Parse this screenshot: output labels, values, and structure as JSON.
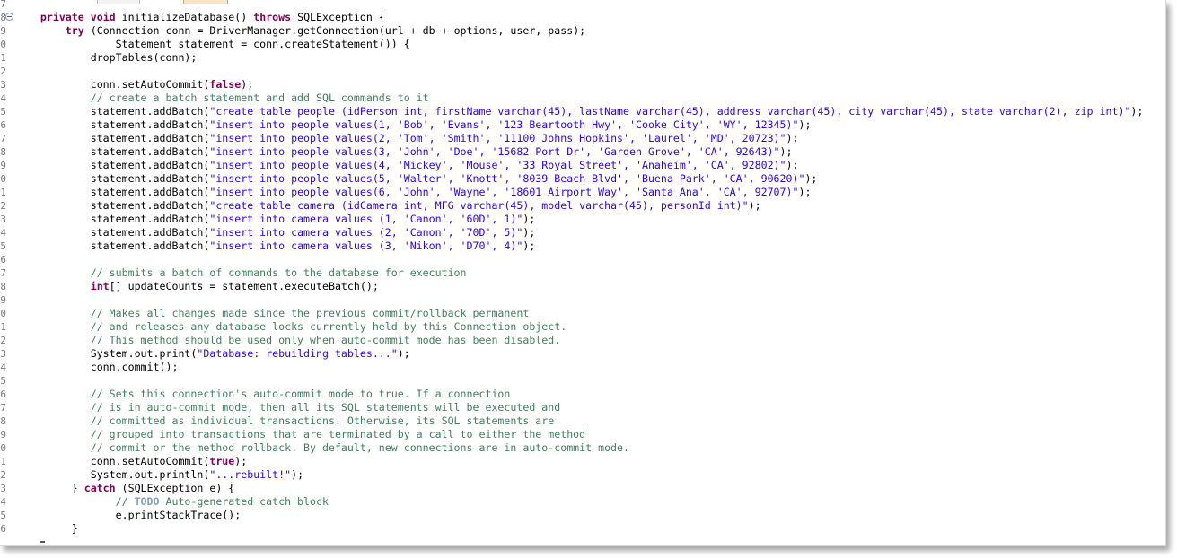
{
  "editor": {
    "lines": [
      {
        "n": "7",
        "indent": 0,
        "text": ""
      },
      {
        "n": "8",
        "indent": 6,
        "fold": true,
        "tokens": [
          {
            "t": "kw",
            "v": "private"
          },
          {
            "t": "p",
            "v": " "
          },
          {
            "t": "kw",
            "v": "void"
          },
          {
            "t": "p",
            "v": " initializeDatabase() "
          },
          {
            "t": "kw",
            "v": "throws"
          },
          {
            "t": "p",
            "v": " SQLException {"
          }
        ]
      },
      {
        "n": "9",
        "indent": 10,
        "tokens": [
          {
            "t": "kw",
            "v": "try"
          },
          {
            "t": "p",
            "v": " (Connection conn = DriverManager.getConnection(url + db + options, user, pass);"
          }
        ]
      },
      {
        "n": "0",
        "indent": 18,
        "tokens": [
          {
            "t": "p",
            "v": "Statement statement = conn.createStatement()) {"
          }
        ]
      },
      {
        "n": "1",
        "indent": 14,
        "tokens": [
          {
            "t": "p",
            "v": "dropTables(conn);"
          }
        ]
      },
      {
        "n": "2",
        "indent": 0,
        "tokens": []
      },
      {
        "n": "3",
        "indent": 14,
        "tokens": [
          {
            "t": "p",
            "v": "conn.setAutoCommit("
          },
          {
            "t": "kw",
            "v": "false"
          },
          {
            "t": "p",
            "v": ");"
          }
        ]
      },
      {
        "n": "4",
        "indent": 14,
        "tokens": [
          {
            "t": "cm",
            "v": "// create a batch statement and add SQL commands to it"
          }
        ]
      },
      {
        "n": "5",
        "indent": 14,
        "tokens": [
          {
            "t": "p",
            "v": "statement.addBatch("
          },
          {
            "t": "str",
            "v": "\"create table people (idPerson int, firstName varchar(45), lastName varchar(45), address varchar(45), city varchar(45), state varchar(2), zip int)\""
          },
          {
            "t": "p",
            "v": ");"
          }
        ]
      },
      {
        "n": "6",
        "indent": 14,
        "tokens": [
          {
            "t": "p",
            "v": "statement.addBatch("
          },
          {
            "t": "str",
            "v": "\"insert into people values(1, 'Bob', 'Evans', '123 Beartooth Hwy', 'Cooke City', 'WY', 12345)\""
          },
          {
            "t": "p",
            "v": ");"
          }
        ]
      },
      {
        "n": "7",
        "indent": 14,
        "tokens": [
          {
            "t": "p",
            "v": "statement.addBatch("
          },
          {
            "t": "str",
            "v": "\"insert into people values(2, 'Tom', 'Smith', '11100 Johns Hopkins', 'Laurel', 'MD', 20723)\""
          },
          {
            "t": "p",
            "v": ");"
          }
        ]
      },
      {
        "n": "8",
        "indent": 14,
        "tokens": [
          {
            "t": "p",
            "v": "statement.addBatch("
          },
          {
            "t": "str",
            "v": "\"insert into people values(3, 'John', 'Doe', '15682 Port Dr', 'Garden Grove', 'CA', 92643)\""
          },
          {
            "t": "p",
            "v": ");"
          }
        ]
      },
      {
        "n": "9",
        "indent": 14,
        "tokens": [
          {
            "t": "p",
            "v": "statement.addBatch("
          },
          {
            "t": "str",
            "v": "\"insert into people values(4, 'Mickey', 'Mouse', '33 Royal Street', 'Anaheim', 'CA', 92802)\""
          },
          {
            "t": "p",
            "v": ");"
          }
        ]
      },
      {
        "n": "0",
        "indent": 14,
        "tokens": [
          {
            "t": "p",
            "v": "statement.addBatch("
          },
          {
            "t": "str",
            "v": "\"insert into people values(5, 'Walter', 'Knott', '8039 Beach Blvd', 'Buena Park', 'CA', 90620)\""
          },
          {
            "t": "p",
            "v": ");"
          }
        ]
      },
      {
        "n": "1",
        "indent": 14,
        "tokens": [
          {
            "t": "p",
            "v": "statement.addBatch("
          },
          {
            "t": "str",
            "v": "\"insert into people values(6, 'John', 'Wayne', '18601 Airport Way', 'Santa Ana', 'CA', 92707)\""
          },
          {
            "t": "p",
            "v": ");"
          }
        ]
      },
      {
        "n": "2",
        "indent": 14,
        "tokens": [
          {
            "t": "p",
            "v": "statement.addBatch("
          },
          {
            "t": "str",
            "v": "\"create table camera (idCamera int, MFG varchar(45), model varchar(45), personId int)\""
          },
          {
            "t": "p",
            "v": ");"
          }
        ]
      },
      {
        "n": "3",
        "indent": 14,
        "tokens": [
          {
            "t": "p",
            "v": "statement.addBatch("
          },
          {
            "t": "str",
            "v": "\"insert into camera values (1, 'Canon', '60D', 1)\""
          },
          {
            "t": "p",
            "v": ");"
          }
        ]
      },
      {
        "n": "4",
        "indent": 14,
        "tokens": [
          {
            "t": "p",
            "v": "statement.addBatch("
          },
          {
            "t": "str",
            "v": "\"insert into camera values (2, 'Canon', '70D', 5)\""
          },
          {
            "t": "p",
            "v": ");"
          }
        ]
      },
      {
        "n": "5",
        "indent": 14,
        "tokens": [
          {
            "t": "p",
            "v": "statement.addBatch("
          },
          {
            "t": "str",
            "v": "\"insert into camera values (3, 'Nikon', 'D70', 4)\""
          },
          {
            "t": "p",
            "v": ");"
          }
        ]
      },
      {
        "n": "6",
        "indent": 0,
        "tokens": []
      },
      {
        "n": "7",
        "indent": 14,
        "tokens": [
          {
            "t": "cm",
            "v": "// submits a batch of commands to the database for execution"
          }
        ]
      },
      {
        "n": "8",
        "indent": 14,
        "tokens": [
          {
            "t": "kw",
            "v": "int"
          },
          {
            "t": "p",
            "v": "[] updateCounts = statement.executeBatch();"
          }
        ]
      },
      {
        "n": "9",
        "indent": 0,
        "tokens": []
      },
      {
        "n": "0",
        "indent": 14,
        "tokens": [
          {
            "t": "cm",
            "v": "// Makes all changes made since the previous commit/rollback permanent"
          }
        ]
      },
      {
        "n": "1",
        "indent": 14,
        "tokens": [
          {
            "t": "cm",
            "v": "// and releases any database locks currently held by this Connection object."
          }
        ]
      },
      {
        "n": "2",
        "indent": 14,
        "tokens": [
          {
            "t": "cm",
            "v": "// This method should be used only when auto-commit mode has been disabled."
          }
        ]
      },
      {
        "n": "3",
        "indent": 14,
        "tokens": [
          {
            "t": "p",
            "v": "System.out.print("
          },
          {
            "t": "str",
            "v": "\"Database: rebuilding tables...\""
          },
          {
            "t": "p",
            "v": ");"
          }
        ]
      },
      {
        "n": "4",
        "indent": 14,
        "tokens": [
          {
            "t": "p",
            "v": "conn.commit();"
          }
        ]
      },
      {
        "n": "5",
        "indent": 0,
        "tokens": []
      },
      {
        "n": "6",
        "indent": 14,
        "tokens": [
          {
            "t": "cm",
            "v": "// Sets this connection's auto-commit mode to true. If a connection"
          }
        ]
      },
      {
        "n": "7",
        "indent": 14,
        "tokens": [
          {
            "t": "cm",
            "v": "// is in auto-commit mode, then all its SQL statements will be executed and"
          }
        ]
      },
      {
        "n": "8",
        "indent": 14,
        "tokens": [
          {
            "t": "cm",
            "v": "// committed as individual transactions. Otherwise, its SQL statements are"
          }
        ]
      },
      {
        "n": "9",
        "indent": 14,
        "tokens": [
          {
            "t": "cm",
            "v": "// grouped into transactions that are terminated by a call to either the method"
          }
        ]
      },
      {
        "n": "0",
        "indent": 14,
        "tokens": [
          {
            "t": "cm",
            "v": "// commit or the method rollback. By default, new connections are in auto-commit mode."
          }
        ]
      },
      {
        "n": "1",
        "indent": 14,
        "tokens": [
          {
            "t": "p",
            "v": "conn.setAutoCommit("
          },
          {
            "t": "kw",
            "v": "true"
          },
          {
            "t": "p",
            "v": ");"
          }
        ]
      },
      {
        "n": "2",
        "indent": 14,
        "tokens": [
          {
            "t": "p",
            "v": "System.out.println("
          },
          {
            "t": "str",
            "v": "\"...rebuilt!\""
          },
          {
            "t": "p",
            "v": ");"
          }
        ]
      },
      {
        "n": "3",
        "indent": 11,
        "tokens": [
          {
            "t": "p",
            "v": "} "
          },
          {
            "t": "kw",
            "v": "catch"
          },
          {
            "t": "p",
            "v": " (SQLException e) {"
          }
        ]
      },
      {
        "n": "4",
        "indent": 18,
        "tokens": [
          {
            "t": "cm",
            "v": "// "
          },
          {
            "t": "todo",
            "v": "TODO"
          },
          {
            "t": "cm",
            "v": " Auto-generated catch block"
          }
        ]
      },
      {
        "n": "5",
        "indent": 18,
        "tokens": [
          {
            "t": "p",
            "v": "e.printStackTrace();"
          }
        ]
      },
      {
        "n": "6",
        "indent": 11,
        "tokens": [
          {
            "t": "p",
            "v": "}"
          }
        ]
      }
    ]
  }
}
